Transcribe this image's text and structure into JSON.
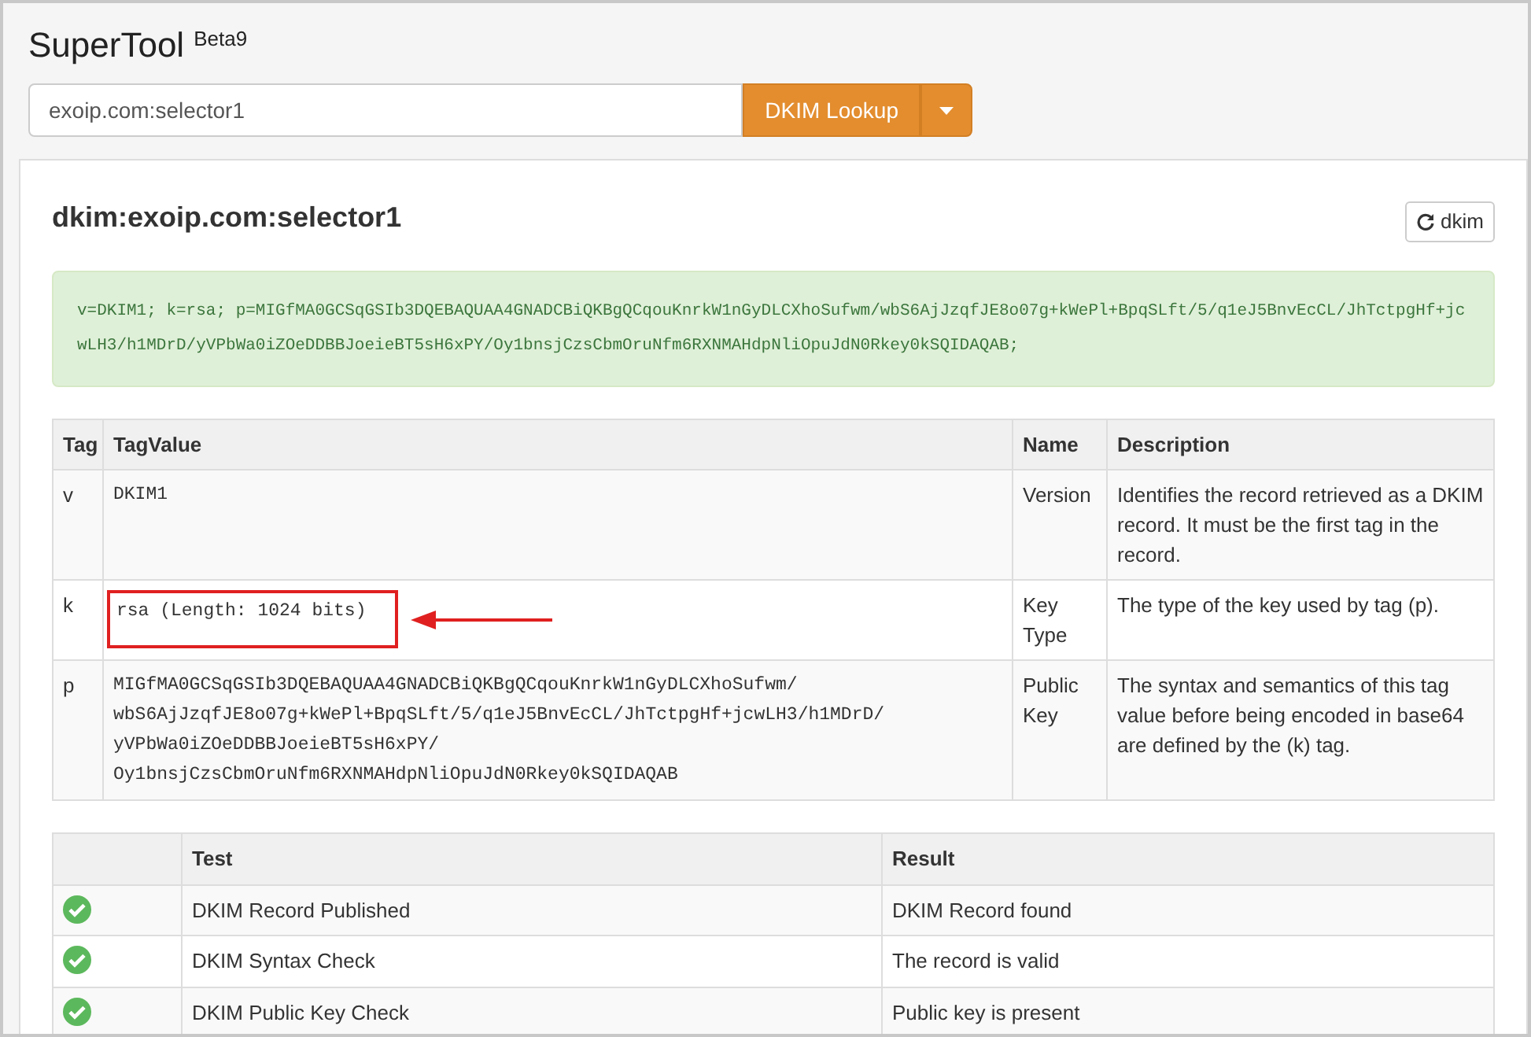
{
  "app": {
    "title": "SuperTool",
    "version": "Beta9"
  },
  "search": {
    "value": "exoip.com:selector1",
    "button": "DKIM Lookup"
  },
  "panel": {
    "title": "dkim:exoip.com:selector1",
    "refresh_button": "dkim"
  },
  "record": "v=DKIM1; k=rsa; p=MIGfMA0GCSqGSIb3DQEBAQUAA4GNADCBiQKBgQCqouKnrkW1nGyDLCXhoSufwm/wbS6AjJzqfJE8o07g+kWePl+BpqSLft/5/q1eJ5BnvEcCL/JhTctpgHf+jcwLH3/h1MDrD/yVPbWa0iZOeDDBBJoeieBT5sH6xPY/Oy1bnsjCzsCbmOruNfm6RXNMAHdpNliOpuJdN0Rkey0kSQIDAQAB;",
  "tag_table": {
    "columns": [
      "Tag",
      "TagValue",
      "Name",
      "Description"
    ],
    "rows": [
      {
        "tag": "v",
        "value": "DKIM1",
        "name": "Version",
        "description": "Identifies the record retrieved as a DKIM record. It must be the first tag in the record.",
        "highlighted": false
      },
      {
        "tag": "k",
        "value": "rsa (Length: 1024 bits)",
        "name": "Key Type",
        "description": "The type of the key used by tag (p).",
        "highlighted": true
      },
      {
        "tag": "p",
        "value": "MIGfMA0GCSqGSIb3DQEBAQUAA4GNADCBiQKBgQCqouKnrkW1nGyDLCXhoSufwm/wbS6AjJzqfJE8o07g+kWePl+BpqSLft/5/q1eJ5BnvEcCL/JhTctpgHf+jcwLH3/h1MDrD/yVPbWa0iZOeDDBBJoeieBT5sH6xPY/Oy1bnsjCzsCbmOruNfm6RXNMAHdpNliOpuJdN0Rkey0kSQIDAQAB",
        "name": "Public Key",
        "description": "The syntax and semantics of this tag value before being encoded in base64 are defined by the (k) tag.",
        "highlighted": false
      }
    ]
  },
  "test_table": {
    "columns": [
      "Test",
      "Result"
    ],
    "rows": [
      {
        "passed": true,
        "test": "DKIM Record Published",
        "result": "DKIM Record found"
      },
      {
        "passed": true,
        "test": "DKIM Syntax Check",
        "result": "The record is valid"
      },
      {
        "passed": true,
        "test": "DKIM Public Key Check",
        "result": "Public key is present"
      }
    ]
  }
}
